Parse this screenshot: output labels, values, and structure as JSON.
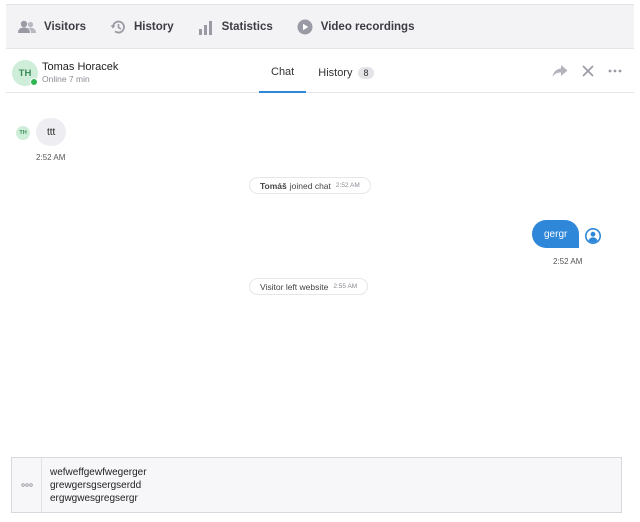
{
  "nav": {
    "items": [
      {
        "label": "Visitors",
        "icon": "visitors-icon"
      },
      {
        "label": "History",
        "icon": "history-icon"
      },
      {
        "label": "Statistics",
        "icon": "statistics-icon"
      },
      {
        "label": "Video recordings",
        "icon": "video-recordings-icon"
      }
    ]
  },
  "header": {
    "avatar_initials": "TH",
    "user_name": "Tomas Horacek",
    "status": "Online 7 min",
    "tabs": [
      {
        "label": "Chat",
        "active": true
      },
      {
        "label": "History",
        "badge": "8",
        "active": false
      }
    ]
  },
  "messages": {
    "visitor": {
      "initials": "TH",
      "text": "ttt",
      "time": "2:52 AM"
    },
    "joined": {
      "name": "Tomáš",
      "text": "joined chat",
      "time": "2:52 AM"
    },
    "agent": {
      "text": "gergr",
      "time": "2:52 AM"
    },
    "left": {
      "text": "Visitor left website",
      "time": "2:55 AM"
    }
  },
  "composer": {
    "lines": [
      "wefweffgewfwegerger",
      "grewgersgsergserdd",
      "ergwgwesgregsergr"
    ]
  },
  "colors": {
    "accent": "#2e87d8",
    "online": "#2fb554",
    "avatar_bg": "#cfeeda",
    "avatar_text": "#3b8a57",
    "nav_bg": "#f3f3f5"
  }
}
